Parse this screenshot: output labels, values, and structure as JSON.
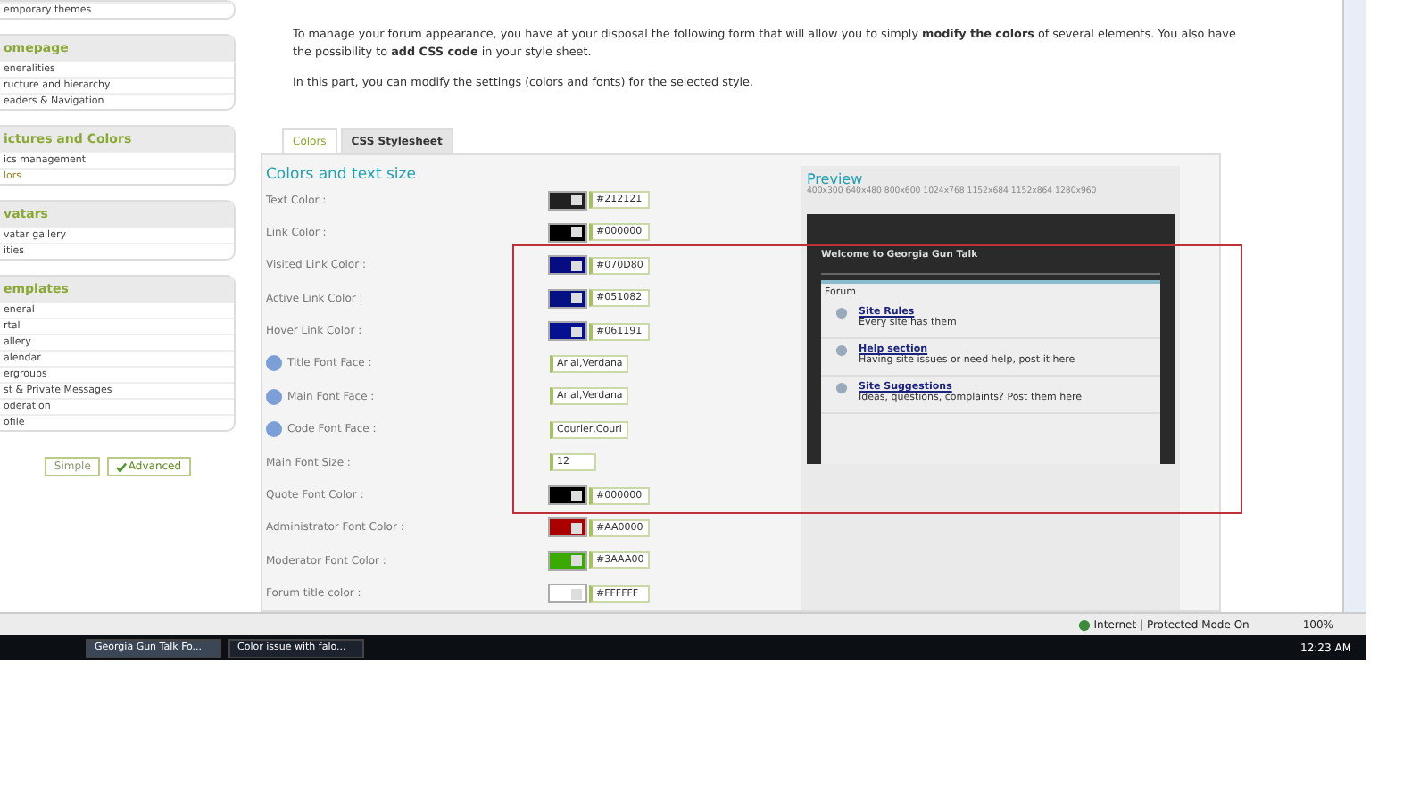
{
  "sidebar": {
    "sections": [
      {
        "items": [
          {
            "label": "emporary themes",
            "selected": false
          }
        ]
      },
      {
        "title": "omepage",
        "items": [
          {
            "label": "eneralities",
            "selected": false
          },
          {
            "label": "ructure and hierarchy",
            "selected": false
          },
          {
            "label": "eaders & Navigation",
            "selected": false
          }
        ]
      },
      {
        "title": "ictures and Colors",
        "items": [
          {
            "label": "ics management",
            "selected": false
          },
          {
            "label": "lors",
            "selected": true
          }
        ]
      },
      {
        "title": "vatars",
        "items": [
          {
            "label": "vatar gallery",
            "selected": false
          },
          {
            "label": "ities",
            "selected": false
          }
        ]
      },
      {
        "title": "emplates",
        "items": [
          {
            "label": "eneral",
            "selected": false
          },
          {
            "label": "rtal",
            "selected": false
          },
          {
            "label": "allery",
            "selected": false
          },
          {
            "label": "alendar",
            "selected": false
          },
          {
            "label": "ergroups",
            "selected": false
          },
          {
            "label": "st & Private Messages",
            "selected": false
          },
          {
            "label": "oderation",
            "selected": false
          },
          {
            "label": "ofile",
            "selected": false
          }
        ]
      }
    ],
    "modes": [
      {
        "label": "Simple",
        "selected": false
      },
      {
        "label": "Advanced",
        "selected": true
      }
    ]
  },
  "intro": [
    "To manage your forum appearance, you have at your disposal the following form that will allow you to simply **modify the colors** of several elements. You also have the possibility to **add CSS code** in your style sheet.",
    "In this part, you can modify the settings (colors and fonts) for the selected style."
  ],
  "tabs": [
    {
      "label": "Colors",
      "selected": true
    },
    {
      "label": "CSS Stylesheet",
      "selected": false
    }
  ],
  "form": {
    "title": "Colors and text size",
    "rows": [
      {
        "label": "Text Color :",
        "help": false,
        "kind": "color",
        "color": "#212121",
        "value": "#212121"
      },
      {
        "label": "Link Color :",
        "help": false,
        "kind": "color",
        "color": "#000000",
        "value": "#000000"
      },
      {
        "label": "Visited Link Color :",
        "help": false,
        "kind": "color",
        "color": "#070d80",
        "value": "#070D80"
      },
      {
        "label": "Active Link Color :",
        "help": false,
        "kind": "color",
        "color": "#051082",
        "value": "#051082"
      },
      {
        "label": "Hover Link Color :",
        "help": false,
        "kind": "color",
        "color": "#061191",
        "value": "#061191"
      },
      {
        "label": "Title Font Face :",
        "help": true,
        "kind": "text",
        "value": "Arial,Verdana"
      },
      {
        "label": "Main Font Face :",
        "help": true,
        "kind": "text",
        "value": "Arial,Verdana"
      },
      {
        "label": "Code Font Face :",
        "help": true,
        "kind": "text",
        "value": "Courier,Couri"
      },
      {
        "label": "Main Font Size :",
        "help": false,
        "kind": "size",
        "value": "12"
      },
      {
        "label": "Quote Font Color :",
        "help": false,
        "kind": "color",
        "color": "#000000",
        "value": "#000000"
      },
      {
        "label": "Administrator Font Color :",
        "help": false,
        "kind": "color",
        "color": "#aa0000",
        "value": "#AA0000"
      },
      {
        "label": "Moderator Font Color :",
        "help": false,
        "kind": "color",
        "color": "#3aaa00",
        "value": "#3AAA00"
      },
      {
        "label": "Forum title color :",
        "help": false,
        "kind": "color",
        "color": "#ffffff",
        "value": "#FFFFFF"
      }
    ]
  },
  "preview": {
    "title": "Preview",
    "resolutions": "400x300 640x480 800x600 1024x768 1152x684 1152x864 1280x960",
    "welcome": "Welcome to Georgia Gun Talk",
    "heading": "Forum",
    "forums": [
      {
        "title": "Site Rules",
        "description": "Every site has them"
      },
      {
        "title": "Help section",
        "description": "Having site issues or need help, post it here"
      },
      {
        "title": "Site Suggestions",
        "description": "Ideas, questions, complaints? Post them here"
      }
    ]
  },
  "status_bar": {
    "zone": "Internet | Protected Mode On",
    "zoom": "100%"
  },
  "taskbar": {
    "windows": [
      {
        "label": "Georgia Gun Talk Fo...",
        "selected": true
      },
      {
        "label": "Color issue with falo...",
        "selected": false
      }
    ],
    "clock": "12:23 AM"
  }
}
